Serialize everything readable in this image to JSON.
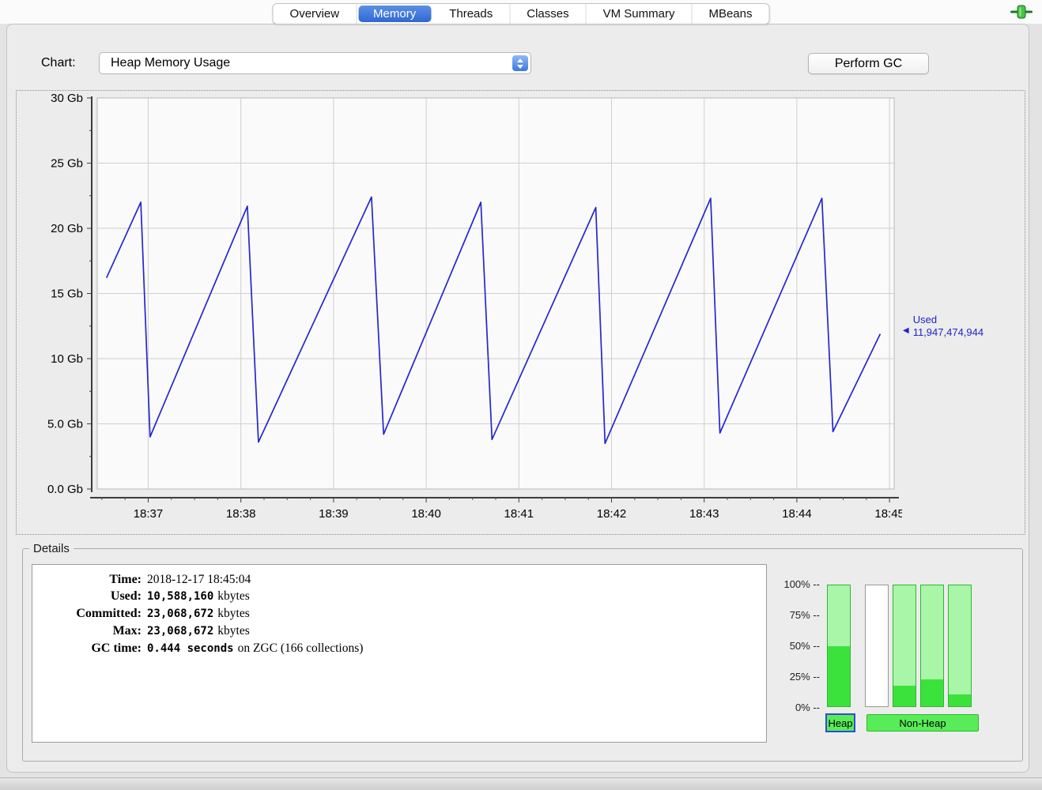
{
  "window": {
    "tabs": [
      {
        "label": "Overview",
        "selected": false
      },
      {
        "label": "Memory",
        "selected": true
      },
      {
        "label": "Threads",
        "selected": false
      },
      {
        "label": "Classes",
        "selected": false
      },
      {
        "label": "VM Summary",
        "selected": false
      },
      {
        "label": "MBeans",
        "selected": false
      }
    ],
    "connection_icon": "green-plug-connected"
  },
  "toolbar": {
    "chart_label": "Chart:",
    "chart_select_value": "Heap Memory Usage",
    "perform_gc_label": "Perform GC"
  },
  "chart_data": {
    "type": "line",
    "title": "Heap Memory Usage",
    "x_note": "x values are minutes past 18:00",
    "xlim": [
      36.45,
      45.05
    ],
    "ylim": [
      0,
      30
    ],
    "x_minor_step": 0.25,
    "y_minor_step": 2.5,
    "grid": true,
    "x_ticks": [
      {
        "v": 37,
        "label": "18:37"
      },
      {
        "v": 38,
        "label": "18:38"
      },
      {
        "v": 39,
        "label": "18:39"
      },
      {
        "v": 40,
        "label": "18:40"
      },
      {
        "v": 41,
        "label": "18:41"
      },
      {
        "v": 42,
        "label": "18:42"
      },
      {
        "v": 43,
        "label": "18:43"
      },
      {
        "v": 44,
        "label": "18:44"
      },
      {
        "v": 45,
        "label": "18:45"
      }
    ],
    "y_ticks": [
      {
        "v": 0,
        "label": "0.0 Gb"
      },
      {
        "v": 5,
        "label": "5.0 Gb"
      },
      {
        "v": 10,
        "label": "10 Gb"
      },
      {
        "v": 15,
        "label": "15 Gb"
      },
      {
        "v": 20,
        "label": "20 Gb"
      },
      {
        "v": 25,
        "label": "25 Gb"
      },
      {
        "v": 30,
        "label": "30 Gb"
      }
    ],
    "series": [
      {
        "name": "Used",
        "unit": "Gb",
        "color": "#2626cf",
        "points": [
          [
            36.55,
            16.2
          ],
          [
            36.92,
            22.0
          ],
          [
            37.02,
            4.0
          ],
          [
            38.07,
            21.7
          ],
          [
            38.19,
            3.6
          ],
          [
            39.41,
            22.4
          ],
          [
            39.54,
            4.2
          ],
          [
            40.59,
            22.0
          ],
          [
            40.71,
            3.8
          ],
          [
            41.83,
            21.6
          ],
          [
            41.93,
            3.5
          ],
          [
            43.07,
            22.3
          ],
          [
            43.17,
            4.3
          ],
          [
            44.27,
            22.3
          ],
          [
            44.39,
            4.4
          ],
          [
            44.9,
            11.9
          ]
        ]
      }
    ],
    "annotation": {
      "label": "Used",
      "value": "11,947,474,944"
    }
  },
  "details": {
    "legend": "Details",
    "rows": [
      {
        "label": "Time:",
        "value": "2018-12-17 18:45:04",
        "mono": false,
        "suffix": ""
      },
      {
        "label": "Used:",
        "value": "10,588,160",
        "mono": true,
        "suffix": "kbytes"
      },
      {
        "label": "Committed:",
        "value": "23,068,672",
        "mono": true,
        "suffix": "kbytes"
      },
      {
        "label": "Max:",
        "value": "23,068,672",
        "mono": true,
        "suffix": "kbytes"
      },
      {
        "label": "GC time:",
        "value": "0.444 seconds",
        "mono": true,
        "suffix": "on ZGC (166 collections)"
      }
    ],
    "bars": {
      "axis_labels": [
        "100% --",
        "75% --",
        "50% --",
        "25% --",
        "0% --"
      ],
      "pools": [
        {
          "name": "heap",
          "fill_pct": 50,
          "empty": false
        },
        {
          "name": "non-heap-1",
          "fill_pct": 0,
          "empty": true
        },
        {
          "name": "non-heap-2",
          "fill_pct": 17,
          "empty": false
        },
        {
          "name": "non-heap-3",
          "fill_pct": 22,
          "empty": false
        },
        {
          "name": "non-heap-4",
          "fill_pct": 10,
          "empty": false
        }
      ],
      "heap_button": "Heap",
      "nonheap_button": "Non-Heap"
    }
  }
}
